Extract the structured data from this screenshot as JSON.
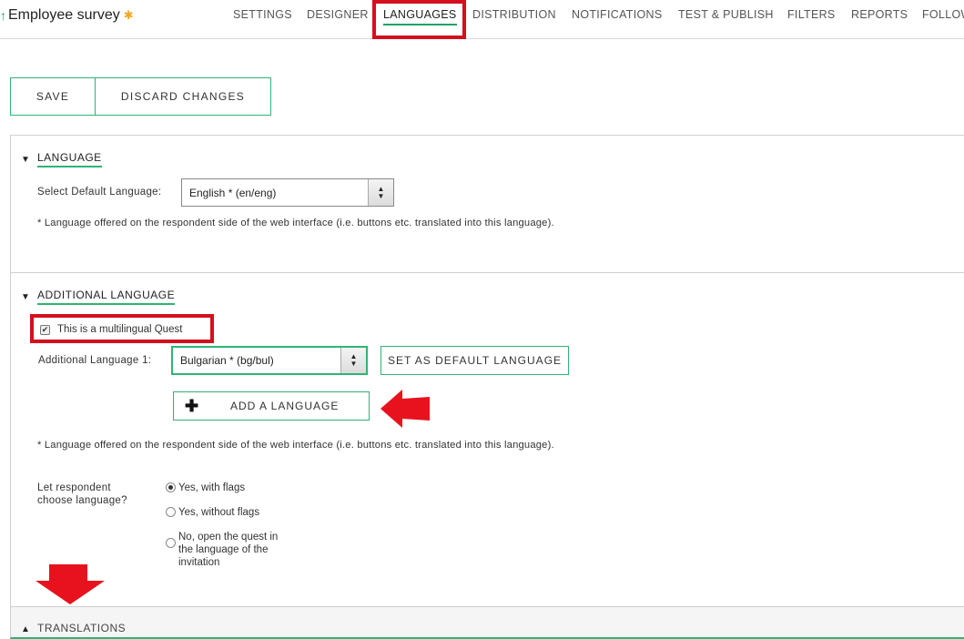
{
  "header": {
    "survey_title": "Employee survey",
    "up_icon": "arrow-up-icon",
    "star_icon": "asterisk-icon",
    "tabs": [
      {
        "label": "SETTINGS"
      },
      {
        "label": "DESIGNER"
      },
      {
        "label": "LANGUAGES",
        "active": true
      },
      {
        "label": "DISTRIBUTION"
      },
      {
        "label": "NOTIFICATIONS"
      },
      {
        "label": "TEST & PUBLISH"
      },
      {
        "label": "FILTERS"
      },
      {
        "label": "REPORTS"
      },
      {
        "label": "FOLLOW"
      }
    ]
  },
  "actions": {
    "save_label": "SAVE",
    "discard_label": "DISCARD CHANGES"
  },
  "language_section": {
    "title": "LANGUAGE",
    "default_label": "Select Default Language:",
    "default_value": "English * (en/eng)",
    "note": "* Language offered on the respondent side of the web interface (i.e. buttons etc. translated into this language)."
  },
  "additional_section": {
    "title": "ADDITIONAL LANGUAGE",
    "multilingual_label": "This is a multilingual Quest",
    "multilingual_checked": true,
    "additional_label": "Additional Language 1:",
    "additional_value": "Bulgarian * (bg/bul)",
    "set_default_label": "SET AS DEFAULT LANGUAGE",
    "add_language_label": "ADD A LANGUAGE",
    "note": "* Language offered on the respondent side of the web interface (i.e. buttons etc. translated into this language).",
    "choose_label_line1": "Let respondent",
    "choose_label_line2": "choose language?",
    "options": [
      {
        "label": "Yes, with flags",
        "checked": true
      },
      {
        "label": "Yes, without flags",
        "checked": false
      },
      {
        "label_lines": [
          "No, open the quest in",
          "the language of the",
          "invitation"
        ],
        "checked": false
      }
    ]
  },
  "translations_section": {
    "title": "TRANSLATIONS"
  },
  "colors": {
    "accent": "#2db573",
    "highlight": "#d4101e"
  }
}
